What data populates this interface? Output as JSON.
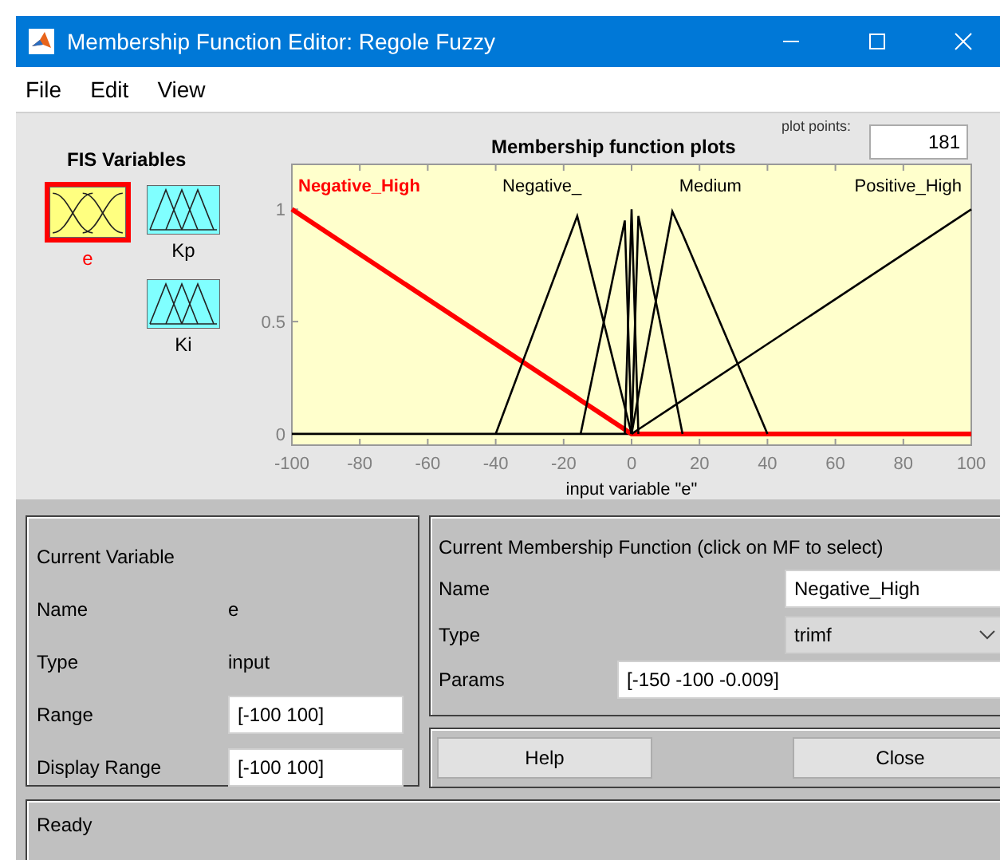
{
  "window": {
    "title": "Membership Function Editor: Regole Fuzzy"
  },
  "menu": [
    "File",
    "Edit",
    "View"
  ],
  "fis_variables": {
    "title": "FIS Variables",
    "items": [
      {
        "label": "e",
        "kind": "input",
        "selected": true
      },
      {
        "label": "Kp",
        "kind": "output",
        "selected": false
      },
      {
        "label": "Ki",
        "kind": "output",
        "selected": false
      }
    ]
  },
  "plot": {
    "title": "Membership function plots",
    "plot_points_label": "plot points:",
    "plot_points": "181",
    "chart_data": {
      "type": "line",
      "xlabel": "input variable \"e\"",
      "x": [
        -100,
        -40,
        -16,
        -15,
        -2,
        0,
        2,
        12,
        15,
        40,
        100
      ],
      "xlim": [
        -100,
        100
      ],
      "ylim": [
        -0.05,
        1.2
      ],
      "xticks": [
        -100,
        -80,
        -60,
        -40,
        -20,
        0,
        20,
        40,
        60,
        80,
        100
      ],
      "yticks": [
        0,
        0.5,
        1
      ],
      "series": [
        {
          "name": "Negative_High",
          "color": "#ff0000",
          "values": [
            1,
            0.4,
            0.16,
            0.15,
            0.02,
            0,
            0,
            0,
            0,
            0,
            0
          ]
        },
        {
          "color": "#000000",
          "values": [
            null,
            0,
            0.97,
            0.91,
            0.12,
            0,
            null,
            null,
            null,
            null,
            null
          ]
        },
        {
          "color": "#000000",
          "values": [
            null,
            null,
            null,
            0,
            0.95,
            0,
            null,
            null,
            null,
            null,
            null
          ]
        },
        {
          "color": "#000000",
          "values": [
            null,
            null,
            null,
            null,
            0,
            1,
            0,
            null,
            null,
            null,
            null
          ]
        },
        {
          "color": "#000000",
          "values": [
            null,
            null,
            null,
            null,
            null,
            0,
            0.97,
            0.23,
            0,
            null,
            null
          ]
        },
        {
          "color": "#000000",
          "values": [
            null,
            null,
            null,
            null,
            null,
            0,
            0.17,
            0.99,
            0.89,
            0,
            null
          ]
        },
        {
          "name": "Positive_High",
          "color": "#000000",
          "values": [
            null,
            null,
            null,
            null,
            null,
            0,
            0.02,
            0.12,
            0.15,
            0.4,
            1
          ]
        }
      ],
      "annotations": [
        "Negative_",
        "Medium"
      ]
    }
  },
  "current_variable": {
    "title": "Current Variable",
    "fields": [
      {
        "label": "Name",
        "value": "e",
        "kind": "text"
      },
      {
        "label": "Type",
        "value": "input",
        "kind": "text"
      },
      {
        "label": "Range",
        "value": "[-100 100]",
        "kind": "input"
      },
      {
        "label": "Display Range",
        "value": "[-100 100]",
        "kind": "input"
      }
    ]
  },
  "current_mf": {
    "title": "Current Membership Function (click on MF to select)",
    "name_label": "Name",
    "name": "Negative_High",
    "type_label": "Type",
    "type": "trimf",
    "params_label": "Params",
    "params": "[-150 -100 -0.009]"
  },
  "buttons": [
    "Help",
    "Close"
  ],
  "status": "Ready"
}
